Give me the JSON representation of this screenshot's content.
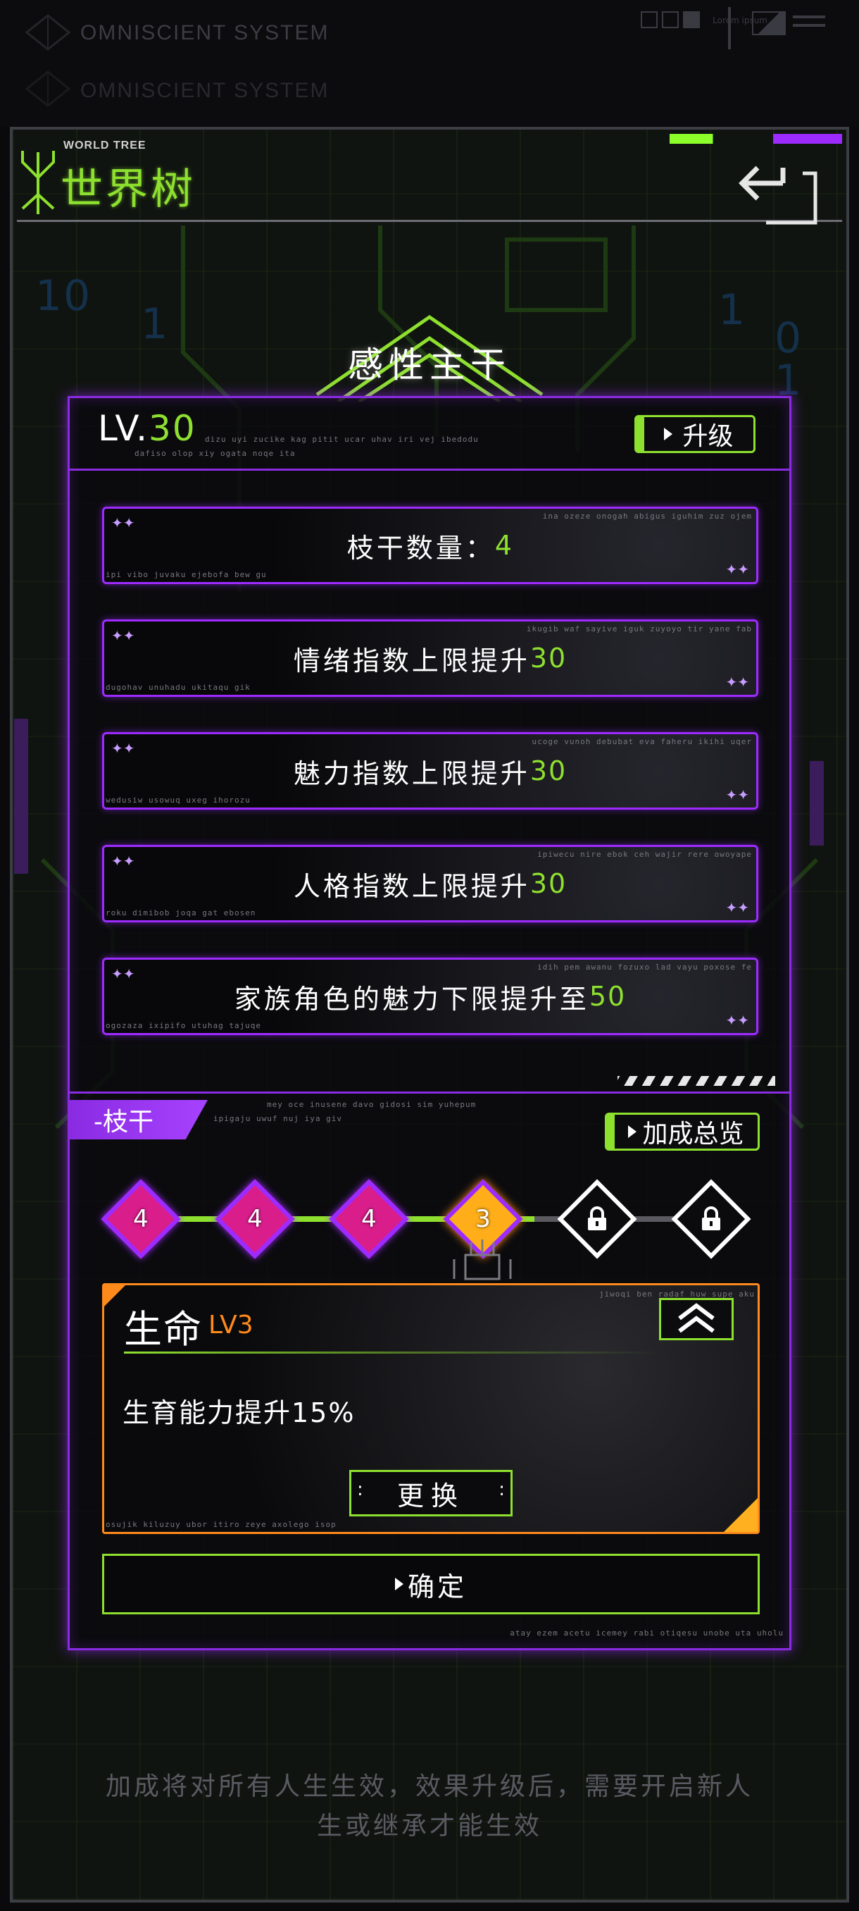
{
  "system_bar": {
    "title": "OMNISCIENT SYSTEM",
    "title_echo": "OMNISCIENT SYSTEM",
    "right_caption": "Lorem ipsum"
  },
  "header": {
    "small_title": "WORLD TREE",
    "title": "世界树",
    "back_icon": "back-arrow-icon"
  },
  "section_title": "感性主干",
  "level": {
    "prefix": "LV.",
    "value": "30",
    "caption1": "dizu uyi zucike kag pitit ucar uhav iri vej ibedodu",
    "caption2": "dafiso olop xiy ogata noqe ita",
    "upgrade_label": "升级"
  },
  "bonuses": [
    {
      "label": "枝干数量：",
      "value": "4",
      "cap_tr": "ina ozeze onogah abigus iguhim zuz ojem",
      "cap_bl": "ipi vibo juvaku ejebofa bew gu"
    },
    {
      "label": "情绪指数上限提升",
      "value": "30",
      "cap_tr": "ikugib waf sayive iguk zuyoyo tir yane fab",
      "cap_bl": "dugohav unuhadu ukitaqu gik"
    },
    {
      "label": "魅力指数上限提升",
      "value": "30",
      "cap_tr": "ucoge vunoh debubat eva faheru ikihi uqer",
      "cap_bl": "wedusiw usowuq uxeg ihorozu"
    },
    {
      "label": "人格指数上限提升",
      "value": "30",
      "cap_tr": "ipiwecu nire ebok ceh wajir rere owoyape",
      "cap_bl": "roku dimibob joqa gat ebosen"
    },
    {
      "label": "家族角色的魅力下限提升至",
      "value": "50",
      "cap_tr": "idih pem awanu fozuxo lad vayu poxose fe",
      "cap_bl": "ogozaza ixipifo utuhag tajuqe"
    }
  ],
  "branch": {
    "tab_label": "-枝干",
    "caption1": "mey oce inusene davo gidosi sim yuhepum",
    "caption2": "ipigaju uwuf nuj iya giv",
    "overview_label": "加成总览",
    "nodes": [
      {
        "label": "4",
        "state": "active",
        "color": "#d91e8c"
      },
      {
        "label": "4",
        "state": "active",
        "color": "#d91e8c"
      },
      {
        "label": "4",
        "state": "active",
        "color": "#d91e8c"
      },
      {
        "label": "3",
        "state": "selected",
        "color": "#ffae1a"
      },
      {
        "label": "",
        "state": "locked",
        "icon": "lock-icon"
      },
      {
        "label": "",
        "state": "locked",
        "icon": "lock-icon"
      }
    ]
  },
  "card": {
    "title": "生命",
    "level": "LV3",
    "description": "生育能力提升15%",
    "caption_tr": "jiwoqi ben radaf huw supe aku",
    "caption_bl": "osujik kiluzuy ubor itiro zeye axolego isop",
    "swap_label": "更换",
    "swap_dots": ":",
    "upgrade_icon": "double-chevron-up-icon"
  },
  "confirm_label": "确定",
  "panel_caption": "atay ezem acetu icemey rabi otiqesu unobe uta uholu",
  "footer_note_line1": "加成将对所有人生生效，效果升级后，需要开启新人",
  "footer_note_line2": "生或继承才能生效",
  "colors": {
    "accent_green": "#8ee02f",
    "accent_purple": "#9d2bff",
    "accent_orange": "#ff8a1c",
    "node_magenta": "#d91e8c",
    "node_gold": "#ffae1a"
  }
}
